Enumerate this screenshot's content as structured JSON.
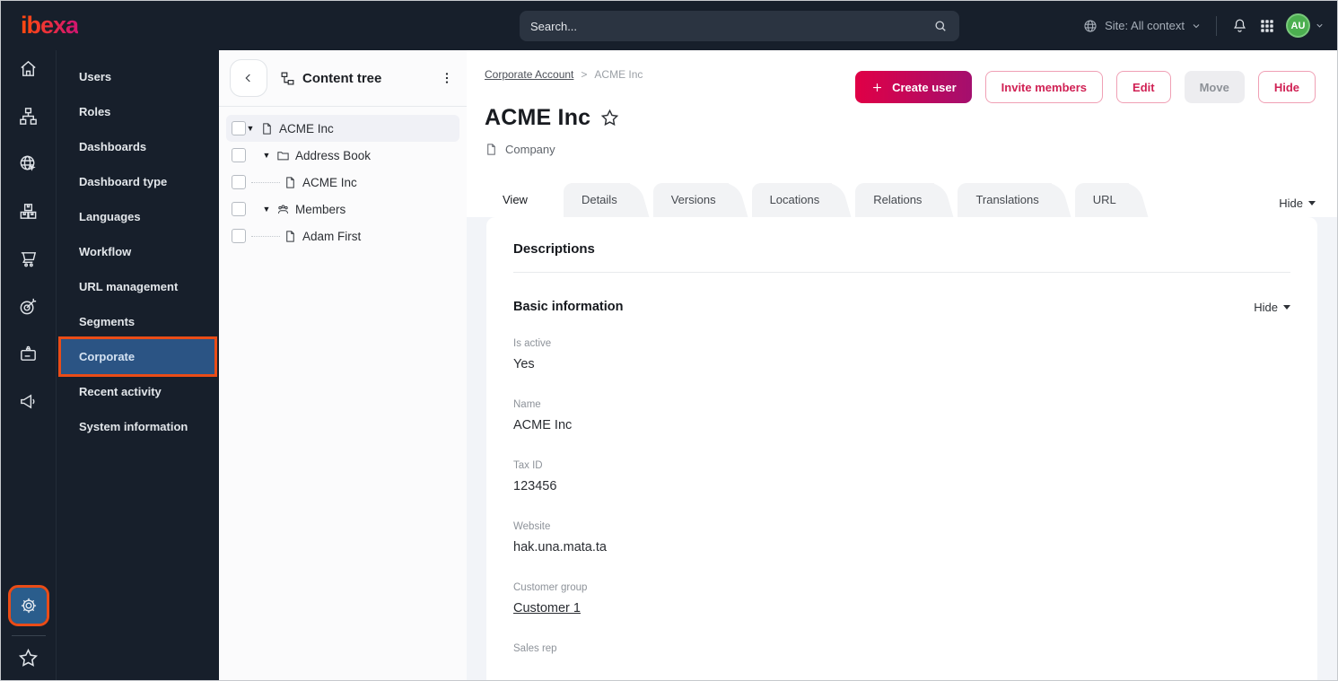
{
  "topbar": {
    "logo_text": "ibexa",
    "search_placeholder": "Search...",
    "site_label": "Site: All context",
    "avatar_initials": "AU"
  },
  "sidebar": {
    "items": [
      "Users",
      "Roles",
      "Dashboards",
      "Dashboard type",
      "Languages",
      "Workflow",
      "URL management",
      "Segments",
      "Corporate",
      "Recent activity",
      "System information"
    ],
    "active_item": "Corporate"
  },
  "content_tree": {
    "title": "Content tree",
    "items": [
      {
        "label": "ACME Inc",
        "type": "document",
        "selected": true
      },
      {
        "label": "Address Book",
        "type": "folder"
      },
      {
        "label": "ACME Inc",
        "type": "document"
      },
      {
        "label": "Members",
        "type": "user-group"
      },
      {
        "label": "Adam First",
        "type": "document"
      }
    ]
  },
  "main": {
    "breadcrumb": {
      "parent": "Corporate Account",
      "separator": ">",
      "current": "ACME Inc"
    },
    "page_title": "ACME Inc",
    "content_type_label": "Company",
    "actions": {
      "create_user": "Create user",
      "invite_members": "Invite members",
      "edit": "Edit",
      "move": "Move",
      "hide": "Hide"
    },
    "tabs": [
      "View",
      "Details",
      "Versions",
      "Locations",
      "Relations",
      "Translations",
      "URL"
    ],
    "active_tab": "View",
    "tabs_hide_label": "Hide",
    "section_title": "Descriptions",
    "group": {
      "title": "Basic information",
      "hide_label": "Hide"
    },
    "fields": [
      {
        "label": "Is active",
        "value": "Yes"
      },
      {
        "label": "Name",
        "value": "ACME Inc"
      },
      {
        "label": "Tax ID",
        "value": "123456"
      },
      {
        "label": "Website",
        "value": "hak.una.mata.ta"
      },
      {
        "label": "Customer group",
        "value": "Customer 1"
      },
      {
        "label": "Sales rep",
        "value": ""
      }
    ]
  },
  "colors": {
    "topbar_bg": "#171f2b",
    "annotation_orange": "#ea4c17",
    "active_item_blue": "#2b5484",
    "settings_blue": "#2a5d8c",
    "primary_gradient_start": "#e00046",
    "primary_gradient_end": "#a40f6e",
    "secondary_button_text": "#d02154",
    "avatar_green": "#4caf50"
  }
}
